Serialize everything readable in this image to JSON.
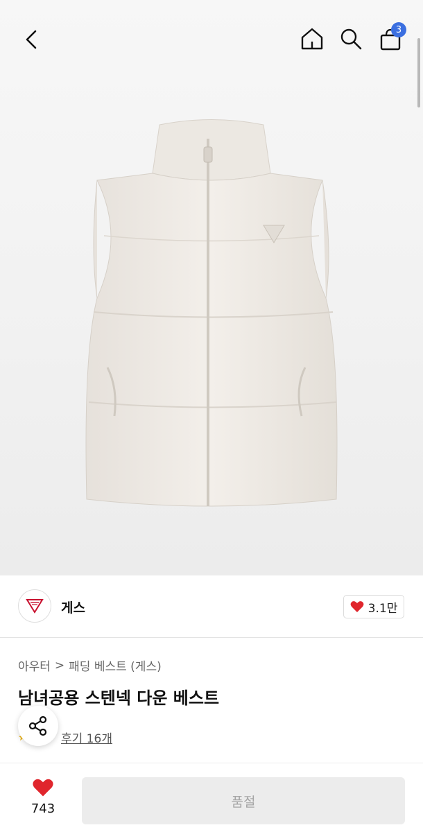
{
  "topbar": {
    "cart_count": "3",
    "icons": [
      "back-arrow-icon",
      "home-icon",
      "search-icon",
      "shopping-bag-icon"
    ]
  },
  "brand": {
    "name": "게스",
    "likes": "3.1만"
  },
  "product": {
    "breadcrumb_category": "아우터",
    "breadcrumb_separator": ">",
    "breadcrumb_subcategory": "패딩 베스트 (게스)",
    "title": "남녀공용 스텐넥 다운 베스트",
    "review_link": "후기 16개"
  },
  "bottom": {
    "wish_count": "743",
    "button_label": "품절"
  },
  "colors": {
    "accent_red": "#e0262d",
    "badge_blue": "#3b6fe0",
    "disabled_button": "#ececec"
  }
}
